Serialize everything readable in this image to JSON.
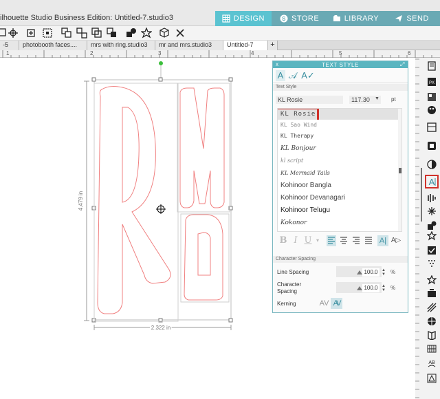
{
  "titlebar": {
    "title": "ilhouette Studio Business Edition: Untitled-7.studio3"
  },
  "nav": [
    {
      "label": "DESIGN",
      "icon": "design-grid-icon",
      "active": true
    },
    {
      "label": "STORE",
      "icon": "store-s-icon",
      "active": false
    },
    {
      "label": "LIBRARY",
      "icon": "library-icon",
      "active": false
    },
    {
      "label": "SEND",
      "icon": "send-icon",
      "active": false
    }
  ],
  "toolbar": [
    "select-icon",
    "crosshair-icon",
    "selection-box-icon",
    "group-icon",
    "ungroup-icon",
    "layer-icon",
    "replicate-icon",
    "star-icon",
    "3d-box-icon",
    "delete-x-icon"
  ],
  "doc_tabs": [
    {
      "label": "-5",
      "active": false
    },
    {
      "label": "photobooth faces....",
      "active": false
    },
    {
      "label": "mrs with ring.studio3",
      "active": false
    },
    {
      "label": "mr and mrs.studio3",
      "active": false
    },
    {
      "label": "Untitled-7",
      "active": true
    }
  ],
  "new_tab": "+",
  "ruler_ticks": [
    "1",
    "2",
    "3",
    "4",
    "5",
    "6"
  ],
  "canvas": {
    "height_label": "4.479 in",
    "width_label": "2.322 in",
    "letters": [
      "R",
      "M",
      "R"
    ]
  },
  "panel": {
    "title": "TEXT STYLE",
    "close": "x",
    "tabs": [
      "A",
      "𝒜",
      "A✓"
    ],
    "text_style_label": "Text Style",
    "font_name": "KL Rosie",
    "font_size": "117.30",
    "size_unit": "pt",
    "fonts": [
      "KL Rosie",
      "KL Sao Wind",
      "KL Therapy",
      "KL Bonjour",
      "kl script",
      "KL Mermaid Tails",
      "Kohinoor Bangla",
      "Kohinoor Devanagari",
      "Kohinoor Telugu",
      "Kokonor"
    ],
    "format_buttons": [
      "B",
      "I",
      "U",
      "▾",
      "align-left-icon",
      "align-center-icon",
      "align-right-icon",
      "justify-icon",
      "A|",
      "A▷"
    ],
    "character_spacing_label": "Character Spacing",
    "line_spacing_label": "Line Spacing",
    "line_spacing_value": "100.0",
    "char_spacing_label": "Character Spacing",
    "char_spacing_value": "100.0",
    "pct": "%",
    "kerning_label": "Kerning",
    "kerning_off": "AV",
    "kerning_on": "AV"
  },
  "right_icons": [
    "page-setup-icon",
    "pixscan-icon",
    "fill-color-icon",
    "line-color-icon",
    "image-effects-icon",
    "shadow-icon",
    "text-style-icon",
    "align-icon",
    "replicate-icon",
    "modify-icon",
    "offset-icon",
    "trace-icon",
    "sketch-icon",
    "favorites-star-icon",
    "cut-settings-icon",
    "stipple-icon",
    "emboss-icon",
    "warp-icon",
    "fold-icon",
    "puzzle-icon",
    "curve-text-icon",
    "rhinestone-icon"
  ],
  "colors": {
    "accent": "#5bc3d1",
    "nav_inactive": "#6aa9b4",
    "highlight": "#d0322b",
    "outline": "#f08080"
  }
}
